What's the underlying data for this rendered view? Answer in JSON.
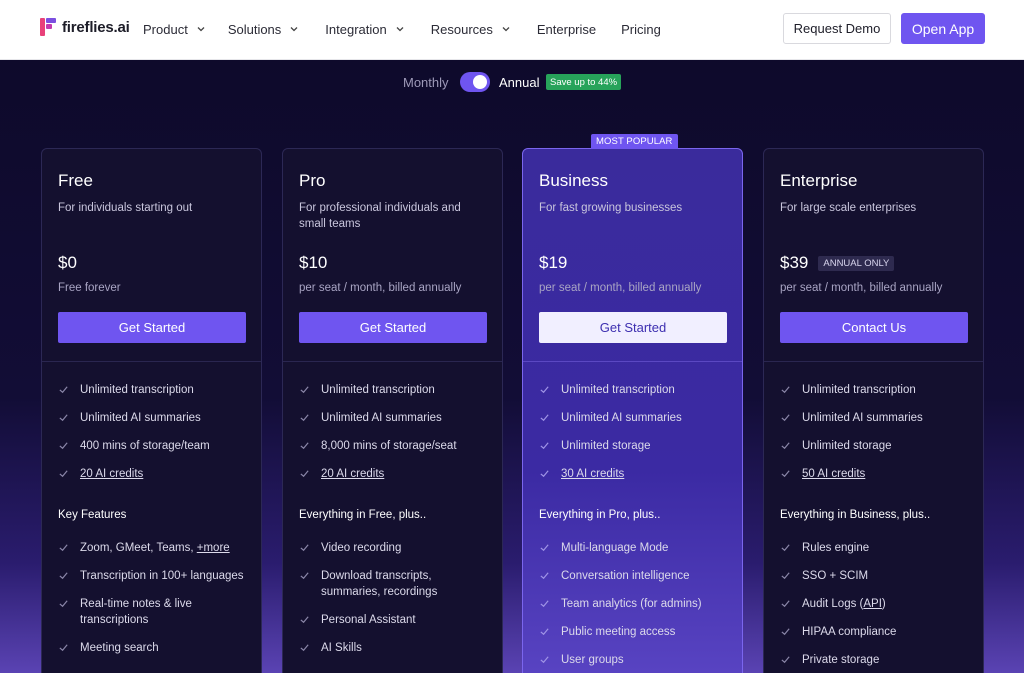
{
  "brand": {
    "name": "fireflies.ai"
  },
  "nav": {
    "items": [
      {
        "label": "Product",
        "has_dropdown": true
      },
      {
        "label": "Solutions",
        "has_dropdown": true
      },
      {
        "label": "Integration",
        "has_dropdown": true
      },
      {
        "label": "Resources",
        "has_dropdown": true
      },
      {
        "label": "Enterprise",
        "has_dropdown": false
      },
      {
        "label": "Pricing",
        "has_dropdown": false
      }
    ],
    "request_demo": "Request Demo",
    "open_app": "Open App"
  },
  "billing": {
    "monthly": "Monthly",
    "annual": "Annual",
    "toggle_state": "annual",
    "save_badge": "Save up to 44%"
  },
  "colors": {
    "accent": "#6f55f0",
    "save_green": "#27a35a",
    "background": "#0f0b2e"
  },
  "plans": [
    {
      "name": "Free",
      "desc": "For individuals starting out",
      "price": "$0",
      "note": "Free forever",
      "cta": "Get Started",
      "features": [
        "Unlimited transcription",
        "Unlimited AI summaries",
        "400 mins of storage/team",
        "20 AI credits"
      ],
      "section": "Key Features",
      "key_features": [
        "Zoom, GMeet, Teams,",
        "Transcription in 100+ languages",
        "Real-time notes & live transcriptions",
        "Meeting search"
      ],
      "more_link": "+more"
    },
    {
      "name": "Pro",
      "desc": "For professional individuals and small teams",
      "price": "$10",
      "note": "per seat / month, billed annually",
      "cta": "Get Started",
      "features": [
        "Unlimited transcription",
        "Unlimited AI summaries",
        "8,000 mins of storage/seat",
        "20 AI credits"
      ],
      "section": "Everything in Free, plus..",
      "key_features": [
        "Video recording",
        "Download transcripts, summaries, recordings",
        "Personal Assistant",
        "AI Skills"
      ]
    },
    {
      "name": "Business",
      "badge": "MOST POPULAR",
      "desc": "For fast growing businesses",
      "price": "$19",
      "note": "per seat / month, billed annually",
      "cta": "Get Started",
      "features": [
        "Unlimited transcription",
        "Unlimited AI summaries",
        "Unlimited storage",
        "30 AI credits"
      ],
      "section": "Everything in Pro, plus..",
      "key_features": [
        "Multi-language Mode",
        "Conversation intelligence",
        "Team analytics (for admins)",
        "Public meeting access",
        "User groups"
      ]
    },
    {
      "name": "Enterprise",
      "price_badge": "ANNUAL ONLY",
      "desc": "For large scale enterprises",
      "price": "$39",
      "note": "per seat / month, billed annually",
      "cta": "Contact Us",
      "features": [
        "Unlimited transcription",
        "Unlimited AI summaries",
        "Unlimited storage",
        "50 AI credits"
      ],
      "section": "Everything in Business, plus..",
      "key_features": [
        "Rules engine",
        "SSO + SCIM",
        "Audit Logs (",
        "HIPAA compliance",
        "Private storage"
      ],
      "api_link": "API",
      "api_suffix": ")"
    }
  ]
}
